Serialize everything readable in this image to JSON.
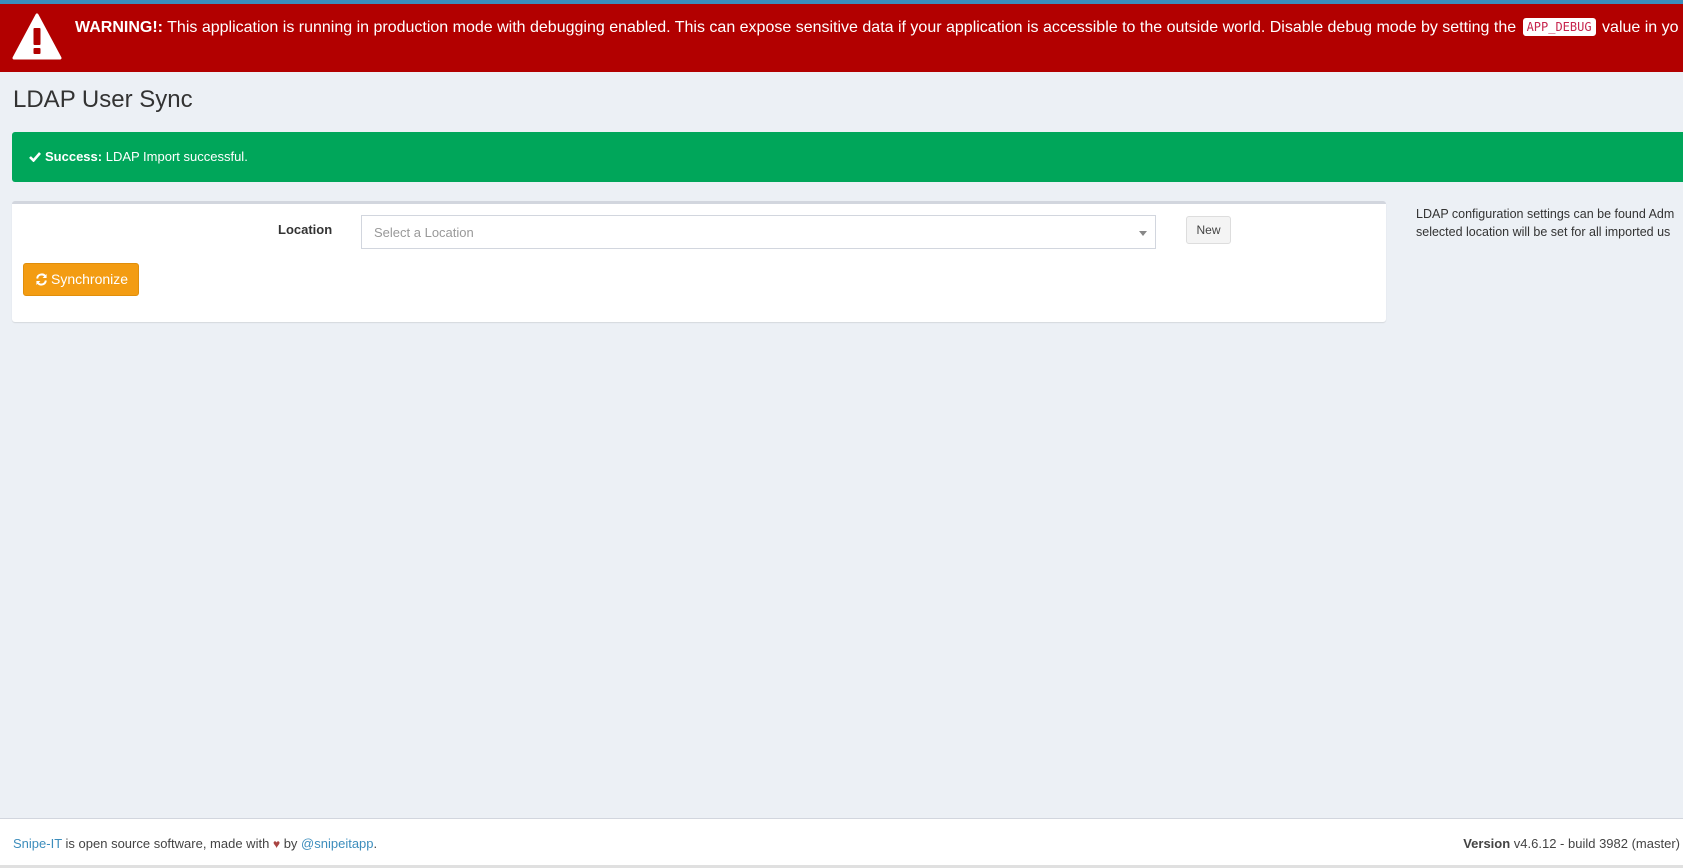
{
  "warning": {
    "label": "WARNING!:",
    "message": "This application is running in production mode with debugging enabled. This can expose sensitive data if your application is accessible to the outside world. Disable debug mode by setting the",
    "code": "APP_DEBUG",
    "suffix": "value in yo"
  },
  "page": {
    "title": "LDAP User Sync"
  },
  "alert": {
    "label": "Success:",
    "message": "LDAP Import successful."
  },
  "form": {
    "location_label": "Location",
    "location_placeholder": "Select a Location",
    "new_label": "New",
    "sync_label": "Synchronize"
  },
  "help": {
    "line1": "LDAP configuration settings can be found Adm",
    "line2": "selected location will be set for all imported us"
  },
  "footer": {
    "brand_link": "Snipe-IT",
    "text_before_heart": "is open source software, made with",
    "heart": "♥",
    "text_by": "by",
    "twitter_link": "@snipeitapp",
    "period": ".",
    "version_label": "Version",
    "version_value": "v4.6.12 - build 3982 (master)"
  },
  "colors": {
    "warning_bg": "#b20000",
    "success_bg": "#00a65a",
    "sync_button": "#f39c12",
    "page_bg": "#ecf0f5",
    "link": "#3c8dbc"
  },
  "icons": {
    "warning": "warning-triangle-icon",
    "success": "check-icon",
    "sync": "refresh-icon",
    "select": "caret-down-icon",
    "footer": "heart-icon"
  }
}
